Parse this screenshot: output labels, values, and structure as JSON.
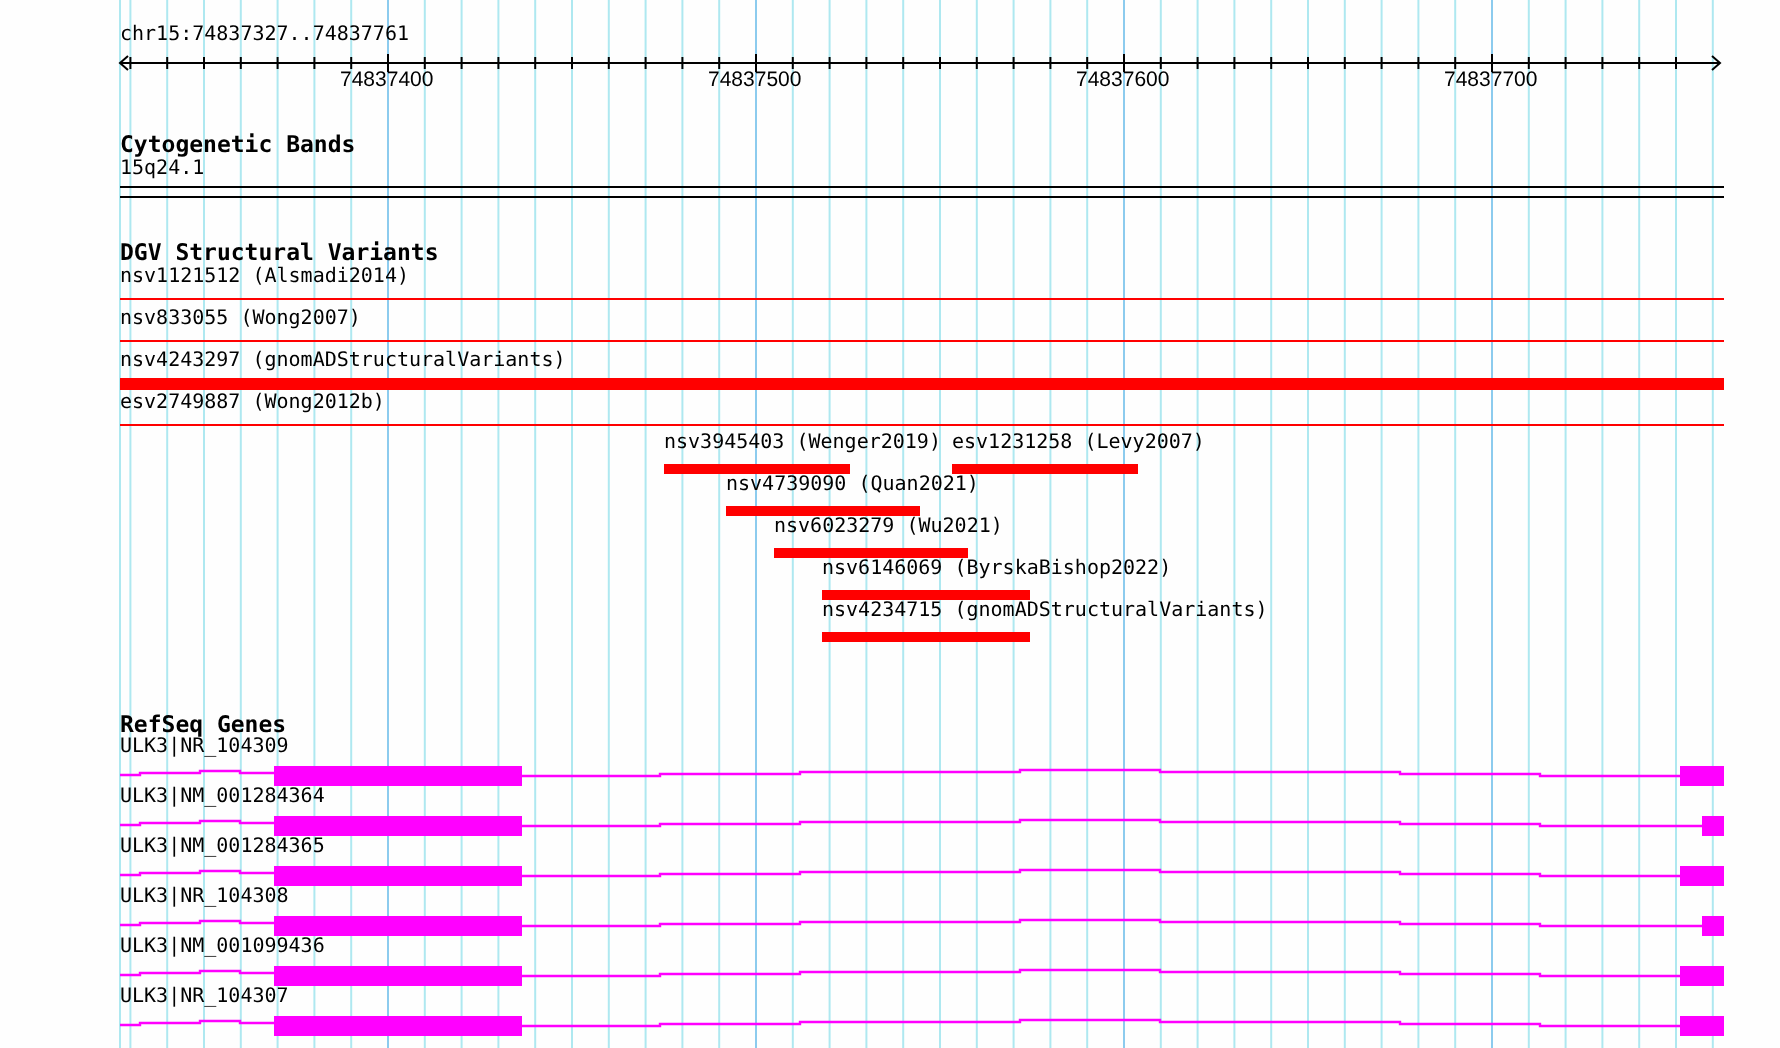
{
  "ruler": {
    "location": "chr15:74837327..74837761",
    "ticks": [
      "74837400",
      "74837500",
      "74837600",
      "74837700"
    ]
  },
  "tracks": [
    {
      "kind": "bands",
      "title": "Cytogenetic Bands",
      "features": [
        {
          "name": "15q24.1"
        }
      ]
    },
    {
      "kind": "variants",
      "title": "DGV Structural Variants",
      "features": [
        {
          "name": "nsv1121512 (Alsmadi2014)",
          "kind": "thin"
        },
        {
          "name": "nsv833055 (Wong2007)",
          "kind": "thin"
        },
        {
          "name": "nsv4243297 (gnomADStructuralVariants)",
          "kind": "thick"
        },
        {
          "name": "esv2749887 (Wong2012b)",
          "kind": "thin"
        },
        {
          "name": "nsv3945403 (Wenger2019)",
          "kind": "block"
        },
        {
          "name": "esv1231258 (Levy2007)",
          "kind": "block"
        },
        {
          "name": "nsv4739090 (Quan2021)",
          "kind": "block"
        },
        {
          "name": "nsv6023279 (Wu2021)",
          "kind": "block"
        },
        {
          "name": "nsv6146069 (ByrskaBishop2022)",
          "kind": "block"
        },
        {
          "name": "nsv4234715 (gnomADStructuralVariants)",
          "kind": "block"
        }
      ]
    },
    {
      "kind": "genes",
      "title": "RefSeq Genes",
      "features": [
        {
          "name": "ULK3|NR_104309"
        },
        {
          "name": "ULK3|NM_001284364"
        },
        {
          "name": "ULK3|NM_001284365"
        },
        {
          "name": "ULK3|NR_104308"
        },
        {
          "name": "ULK3|NM_001099436"
        },
        {
          "name": "ULK3|NR_104307"
        }
      ]
    }
  ]
}
